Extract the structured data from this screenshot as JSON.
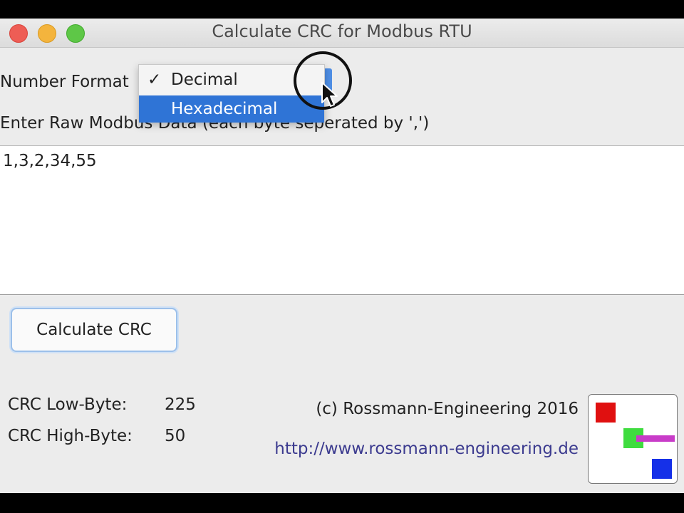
{
  "window": {
    "title": "Calculate CRC for Modbus RTU"
  },
  "form": {
    "number_format_label": "Number Format",
    "raw_data_label": "Enter Raw Modbus Data (each byte seperated by ',')",
    "raw_data_value": "1,3,2,34,55"
  },
  "dropdown": {
    "selected": "Decimal",
    "options": [
      {
        "label": "Decimal",
        "checked": true
      },
      {
        "label": "Hexadecimal",
        "highlighted": true
      }
    ]
  },
  "actions": {
    "calculate_label": "Calculate CRC"
  },
  "results": {
    "low_label": "CRC Low-Byte:",
    "low_value": "225",
    "high_label": "CRC High-Byte:",
    "high_value": "50"
  },
  "footer": {
    "copyright": "(c) Rossmann-Engineering 2016",
    "link": "http://www.rossmann-engineering.de"
  },
  "colors": {
    "accent": "#2f74d6",
    "link": "#3c3b8f",
    "logo_red": "#e01010",
    "logo_green": "#3fdc3f",
    "logo_magenta": "#c83cc8",
    "logo_blue": "#1530e8"
  },
  "icons": [
    "close-icon",
    "minimize-icon",
    "maximize-icon",
    "checkmark-icon",
    "mouse-cursor-icon"
  ]
}
